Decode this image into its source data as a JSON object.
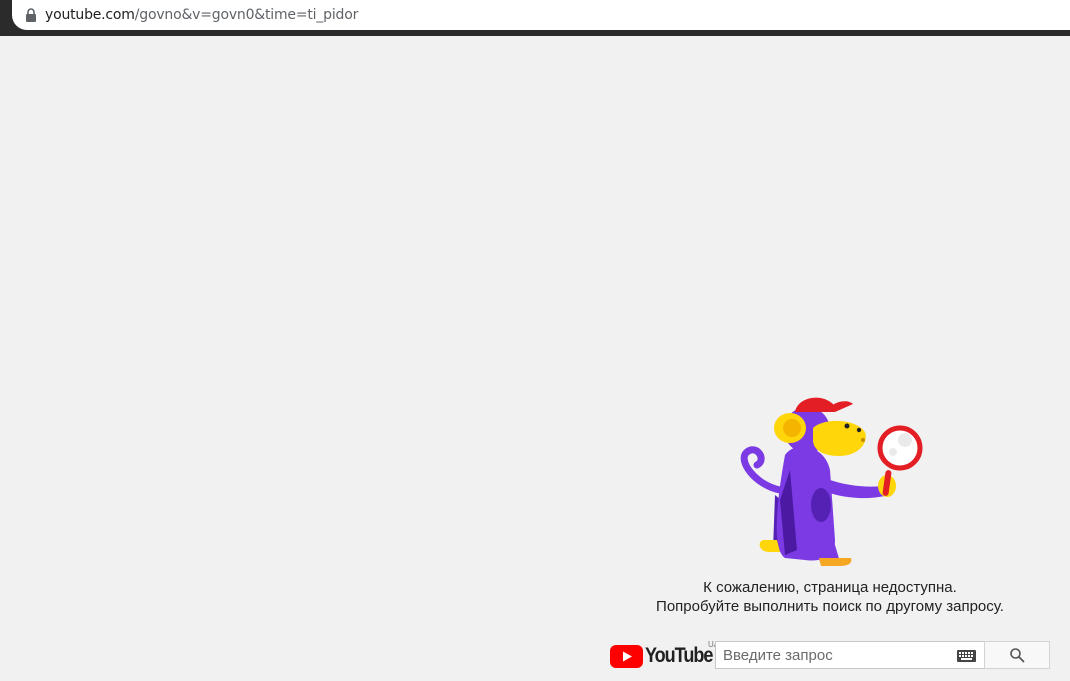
{
  "browser": {
    "url_host": "youtube.com",
    "url_rest": "/govno&v=govn0&time=ti_pidor"
  },
  "error": {
    "line1": "К сожалению, страница недоступна.",
    "line2": "Попробуйте выполнить поиск по другому запросу."
  },
  "logo": {
    "wordmark": "YouTube",
    "region_mark": "UA"
  },
  "search": {
    "placeholder": "Введите запрос",
    "value": ""
  },
  "icons": {
    "lock": "lock-icon",
    "keyboard": "keyboard-icon",
    "search": "search-icon",
    "play": "youtube-play-icon"
  },
  "colors": {
    "page_bg": "#f1f1f1",
    "youtube_red": "#ff0000",
    "monkey_purple": "#6f2dd8",
    "monkey_yellow": "#ffd60a",
    "magnifier_red": "#e31e24"
  }
}
